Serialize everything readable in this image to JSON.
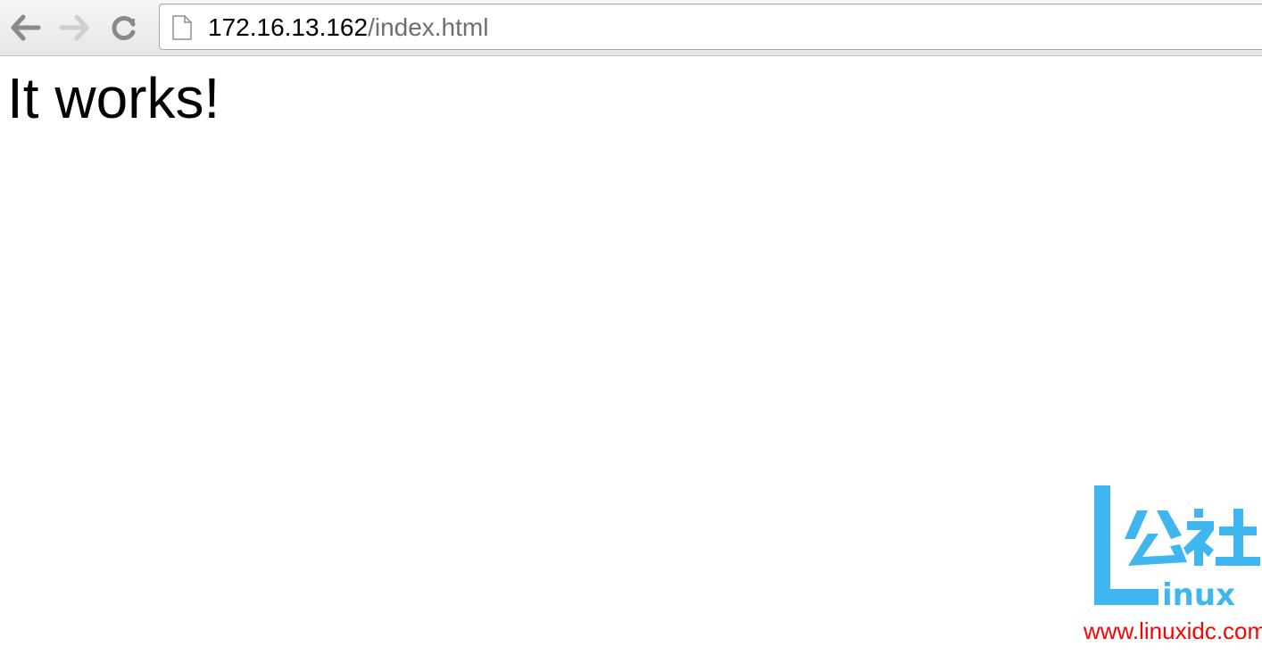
{
  "browser": {
    "nav": {
      "back_icon": "arrow-left-icon",
      "forward_icon": "arrow-right-icon",
      "reload_icon": "reload-icon"
    },
    "address_bar": {
      "page_icon": "document-icon",
      "url_host": "172.16.13.162",
      "url_path": "/index.html"
    }
  },
  "page": {
    "heading": "It works!"
  },
  "watermark": {
    "logo_text": "Linux公社",
    "url": "www.linuxidc.com",
    "colors": {
      "logo": "#3fb6f0",
      "url": "#ff0000"
    }
  }
}
